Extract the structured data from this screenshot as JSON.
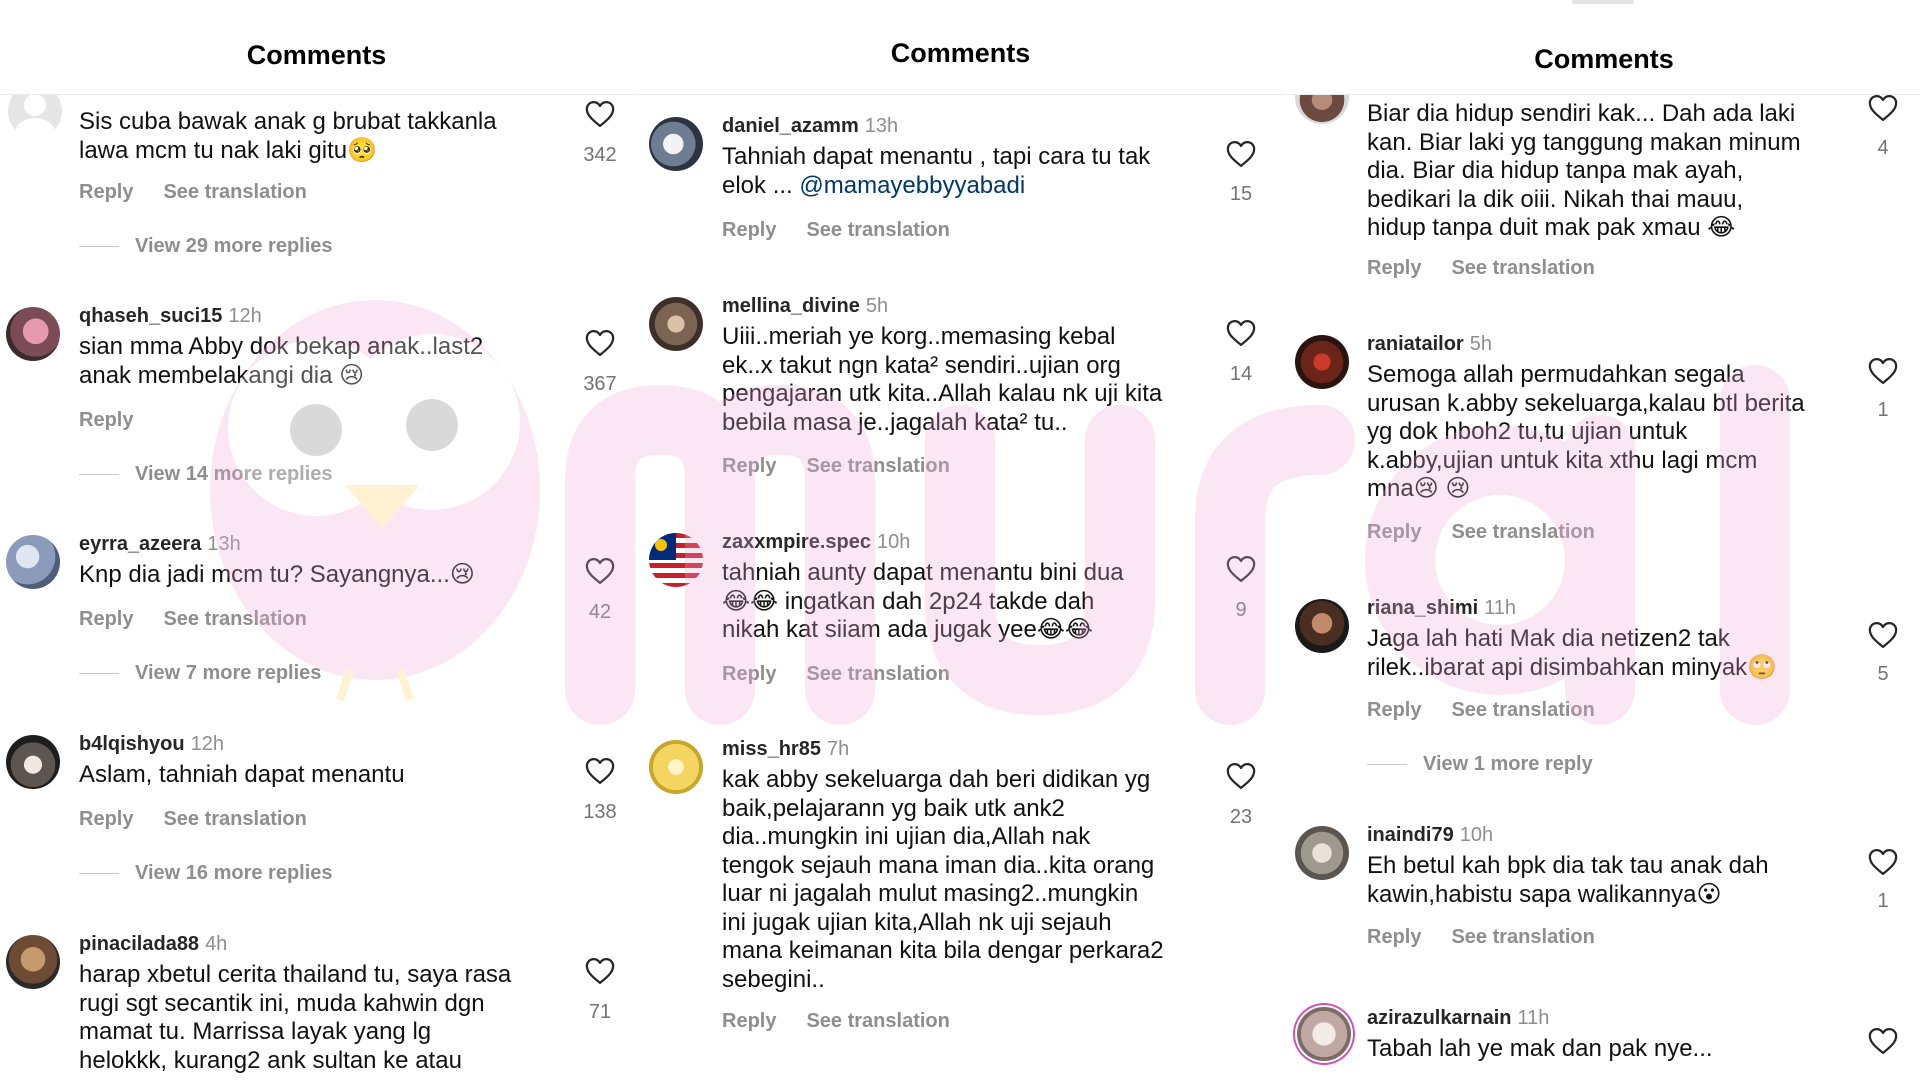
{
  "panels": [
    {
      "title": "Comments",
      "comments": [
        {
          "username": "",
          "time": "",
          "lines": [
            "Sis cuba bawak anak g brubat takkanla",
            "lawa mcm tu nak laki gitu🥺"
          ],
          "likes": "342",
          "reply_label": "Reply",
          "translate_label": "See translation",
          "view_replies": "View 29 more replies"
        },
        {
          "username": "qhaseh_suci15",
          "time": "12h",
          "lines": [
            "sian mma Abby dok bekap anak..last2",
            "anak membelakangi dia 😢"
          ],
          "likes": "367",
          "reply_label": "Reply",
          "translate_label": "",
          "view_replies": "View 14 more replies"
        },
        {
          "username": "eyrra_azeera",
          "time": "13h",
          "lines": [
            "Knp dia jadi mcm tu? Sayangnya...😢"
          ],
          "likes": "42",
          "reply_label": "Reply",
          "translate_label": "See translation",
          "view_replies": "View 7 more replies"
        },
        {
          "username": "b4lqishyou",
          "time": "12h",
          "lines": [
            "Aslam, tahniah dapat menantu"
          ],
          "likes": "138",
          "reply_label": "Reply",
          "translate_label": "See translation",
          "view_replies": "View 16 more replies"
        },
        {
          "username": "pinacilada88",
          "time": "4h",
          "lines": [
            "harap xbetul cerita thailand tu, saya rasa",
            "rugi sgt secantik ini, muda kahwin dgn",
            "mamat tu. Marrissa layak yang lg",
            "helokkk, kurang2 ank sultan ke atau"
          ],
          "likes": "71",
          "reply_label": "",
          "translate_label": "",
          "view_replies": ""
        }
      ]
    },
    {
      "title": "Comments",
      "comments": [
        {
          "username": "daniel_azamm",
          "time": "13h",
          "lines": [
            "Tahniah dapat menantu , tapi cara tu tak",
            "elok ... "
          ],
          "mention": "@mamayebbyyabadi",
          "likes": "15",
          "reply_label": "Reply",
          "translate_label": "See translation",
          "view_replies": ""
        },
        {
          "username": "mellina_divine",
          "time": "5h",
          "lines": [
            "Uiii..meriah ye korg..memasing kebal",
            "ek..x takut ngn kata² sendiri..ujian org",
            "pengajaran utk kita..Allah kalau nk uji kita",
            "bebila masa je..jagalah kata² tu.."
          ],
          "likes": "14",
          "reply_label": "Reply",
          "translate_label": "See translation",
          "view_replies": ""
        },
        {
          "username": "zaxxmpire.spec",
          "time": "10h",
          "lines": [
            "tahniah aunty dapat menantu bini dua",
            "😂😂 ingatkan dah 2p24 takde dah",
            "nikah kat siiam ada jugak yee😂😂"
          ],
          "likes": "9",
          "reply_label": "Reply",
          "translate_label": "See translation",
          "view_replies": ""
        },
        {
          "username": "miss_hr85",
          "time": "7h",
          "lines": [
            "kak abby sekeluarga dah beri didikan yg",
            "baik,pelajarann yg baik utk ank2",
            "dia..mungkin ini ujian dia,Allah nak",
            "tengok sejauh mana iman dia..kita orang",
            "luar ni jagalah mulut masing2..mungkin",
            "ini jugak ujian kita,Allah nk uji sejauh",
            "mana keimanan kita bila dengar perkara2",
            "sebegini.."
          ],
          "likes": "23",
          "reply_label": "Reply",
          "translate_label": "See translation",
          "view_replies": ""
        }
      ]
    },
    {
      "title": "Comments",
      "comments": [
        {
          "username": "",
          "time": "",
          "lines": [
            "Biar dia hidup sendiri kak... Dah ada laki",
            "kan. Biar laki yg tanggung makan minum",
            "dia. Biar dia hidup tanpa mak ayah,",
            "bedikari la dik oiii. Nikah thai mauu,",
            "hidup tanpa duit mak pak xmau 😂"
          ],
          "likes": "4",
          "reply_label": "Reply",
          "translate_label": "See translation",
          "view_replies": ""
        },
        {
          "username": "raniatailor",
          "time": "5h",
          "lines": [
            "Semoga allah permudahkan segala",
            "urusan k.abby sekeluarga,kalau btl berita",
            "yg dok hboh2 tu,tu ujian untuk",
            "k.abby,ujian untuk kita xthu lagi mcm",
            "mna😢 😢"
          ],
          "likes": "1",
          "reply_label": "Reply",
          "translate_label": "See translation",
          "view_replies": ""
        },
        {
          "username": "riana_shimi",
          "time": "11h",
          "lines": [
            "Jaga lah hati Mak dia netizen2 tak",
            "rilek..ibarat api disimbahkan minyak🙄"
          ],
          "likes": "5",
          "reply_label": "Reply",
          "translate_label": "See translation",
          "view_replies": "View 1 more reply"
        },
        {
          "username": "inaindi79",
          "time": "10h",
          "lines": [
            "Eh betul kah bpk dia tak tau anak dah",
            "kawin,habistu sapa walikannya😮"
          ],
          "likes": "1",
          "reply_label": "Reply",
          "translate_label": "See translation",
          "view_replies": ""
        },
        {
          "username": "azirazulkarnain",
          "time": "11h",
          "lines": [
            "Tabah lah ye mak dan pak nye..."
          ],
          "likes": "",
          "reply_label": "",
          "translate_label": "",
          "view_replies": ""
        }
      ]
    }
  ],
  "colors": {
    "text": "#111111",
    "muted": "#8e8e8e",
    "mention": "#00376b",
    "watermark": "#f2c6e2"
  },
  "icons": {
    "like": "heart-outline-icon"
  },
  "watermark": {
    "logo_text": "murai"
  }
}
